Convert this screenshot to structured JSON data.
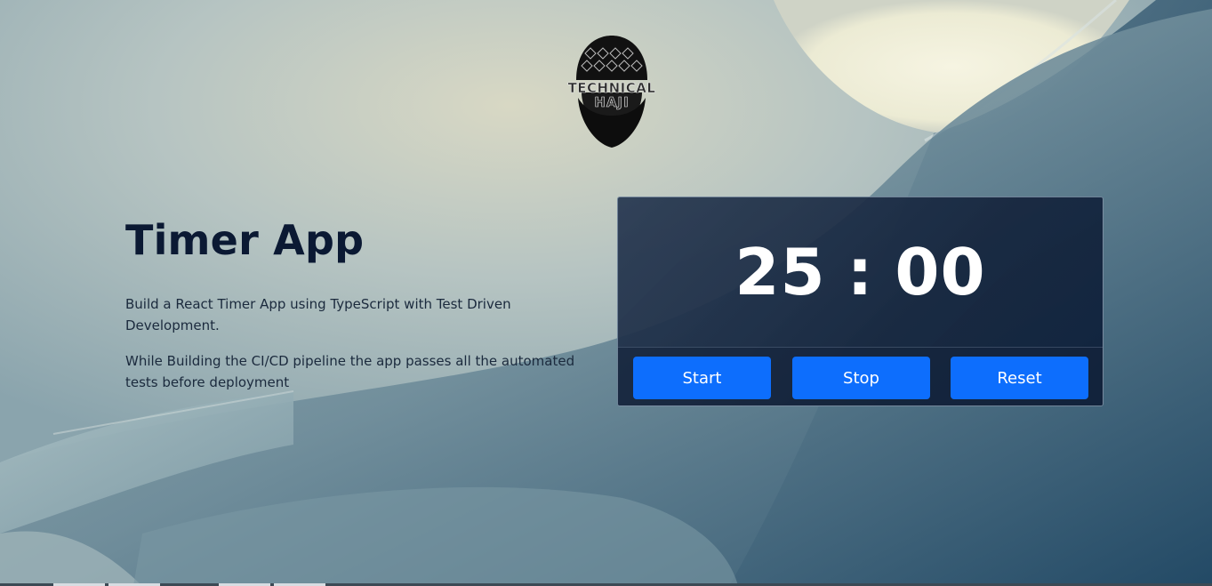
{
  "logo": {
    "alt": "Technical Haji logo",
    "line1": "TECHNICAL",
    "line2": "HAJI"
  },
  "hero": {
    "title": "Timer App",
    "description1": "Build a React Timer App using TypeScript with Test Driven Development.",
    "description2": "While Building the CI/CD pipeline the app passes all the automated tests before deployment"
  },
  "timer": {
    "minutes": "25",
    "separator": ":",
    "seconds": "00",
    "buttons": {
      "start": "Start",
      "stop": "Stop",
      "reset": "Reset"
    }
  },
  "colors": {
    "accent": "#0d6efd",
    "title": "#0b1933",
    "card": "#1a2c47"
  },
  "icons": {
    "logo": "bearded-face-logo"
  }
}
